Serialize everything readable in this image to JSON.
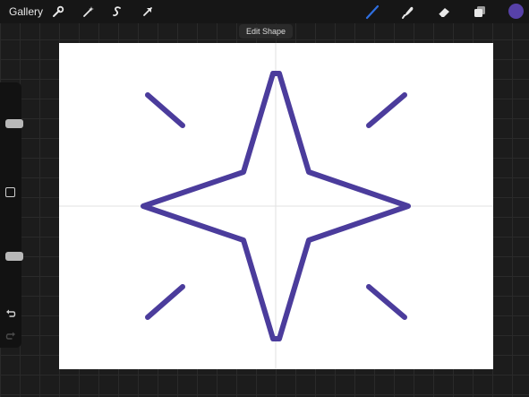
{
  "app": {
    "gallery_label": "Gallery"
  },
  "toolbar": {
    "advanced": [
      {
        "name": "actions",
        "icon": "wrench-icon"
      },
      {
        "name": "adjustments",
        "icon": "magic-wand-icon"
      },
      {
        "name": "selection",
        "icon": "selection-s-icon"
      },
      {
        "name": "transform",
        "icon": "arrow-cursor-icon"
      }
    ],
    "tools": [
      {
        "name": "brush",
        "icon": "brush-icon",
        "active": true
      },
      {
        "name": "smudge",
        "icon": "smudge-icon",
        "active": false
      },
      {
        "name": "eraser",
        "icon": "eraser-icon",
        "active": false
      },
      {
        "name": "layers",
        "icon": "layers-icon",
        "active": false
      }
    ],
    "current_color": "#5741a8"
  },
  "tooltip": {
    "text": "Edit Shape"
  },
  "canvas": {
    "background": "#ffffff",
    "stroke_color": "#4b3c9c",
    "guide_color": "#e2e2e2",
    "shape": "four-point-star",
    "accent_lines": 4
  },
  "sidebar": {
    "brush_size_level": 0.35,
    "opacity_level": 0.65,
    "icons": [
      "modify-square-icon",
      "undo-icon",
      "redo-icon"
    ]
  },
  "colors": {
    "active_tool": "#2f6fe0",
    "inactive_tool": "#e8e8e8"
  }
}
